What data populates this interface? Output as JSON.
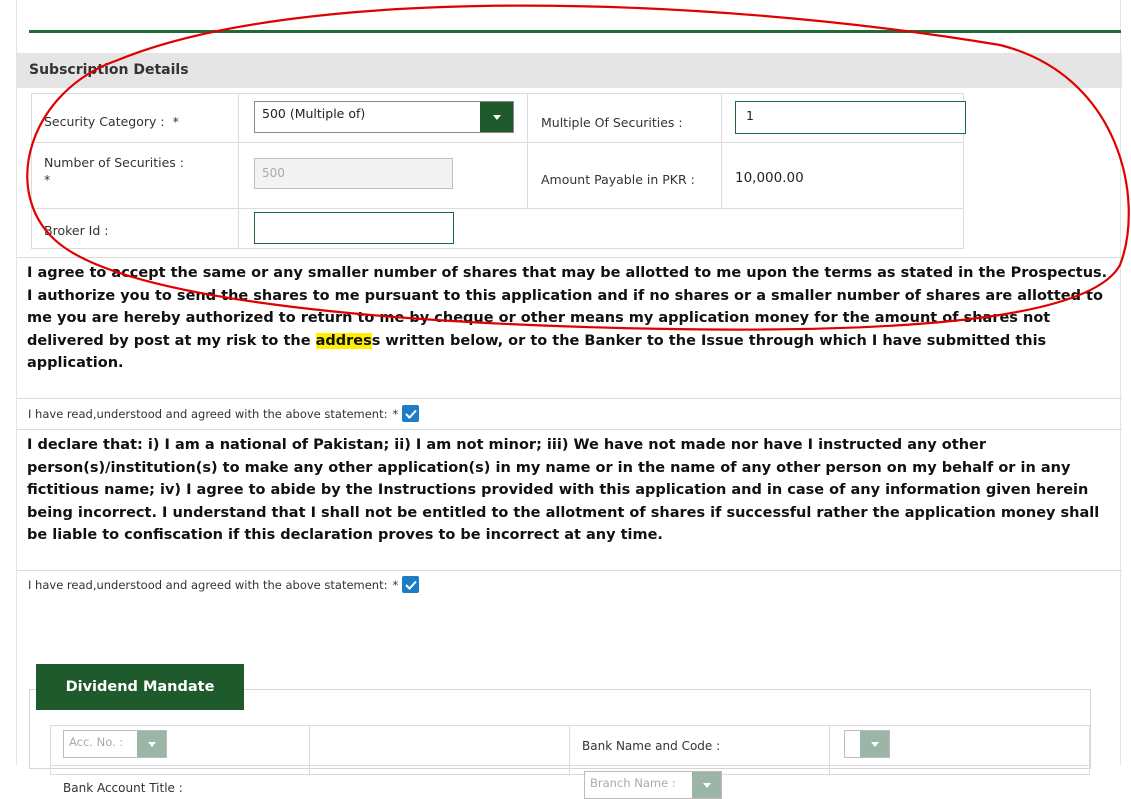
{
  "subscription": {
    "header": "Subscription Details",
    "security_category_label": "Security Category :",
    "required_mark": "*",
    "security_category_value": "500 (Multiple of)",
    "multiple_label": "Multiple Of Securities :",
    "multiple_value": "1",
    "number_label": "Number of Securities :",
    "number_value": "500",
    "amount_label": "Amount Payable in PKR :",
    "amount_value": "10,000.00",
    "broker_label": "Broker Id :",
    "broker_value": ""
  },
  "terms": {
    "para1_part1": "I agree to accept the same or any smaller number of shares that may be allotted to me upon the terms as stated in the Prospectus. I authorize you to send the shares to me pursuant to this application and if no shares or a smaller number of shares are allotted to me you are hereby authorized to return to me by cheque or other means my application money for the amount of shares not delivered by post at my risk to the ",
    "para1_highlight": "addres",
    "para1_part2": "s written below, or to the Banker to the Issue through which I have submitted this application.",
    "agree1_label": "I have read,understood and agreed with the above statement:",
    "agree1_required": "*",
    "agree1_checked": true,
    "para2": "I declare that: i) I am a national of Pakistan; ii) I am not minor; iii) We have not made nor have I instructed any other person(s)/institution(s) to make any other application(s) in my name or in the name of any other person on my behalf or in any fictitious name; iv) I agree to abide by the Instructions provided with this application and in case of any information given herein being incorrect. I understand that I shall not be entitled to the allotment of shares if successful rather the application money shall be liable to confiscation if this declaration proves to be incorrect at any time.",
    "agree2_label": "I have read,understood and agreed with the above statement:",
    "agree2_required": "*",
    "agree2_checked": true
  },
  "dividend": {
    "legend": "Dividend Mandate",
    "acc_no_placeholder": "Acc. No. :",
    "bank_name_label": "Bank Name and Code :",
    "account_title_label": "Bank Account Title :",
    "branch_placeholder": "Branch Name :"
  },
  "colors": {
    "brand_green": "#1e5a2c",
    "checkbox_blue": "#1d7cc6",
    "highlight_yellow": "#ffee00",
    "annotation_red": "#e00000"
  }
}
